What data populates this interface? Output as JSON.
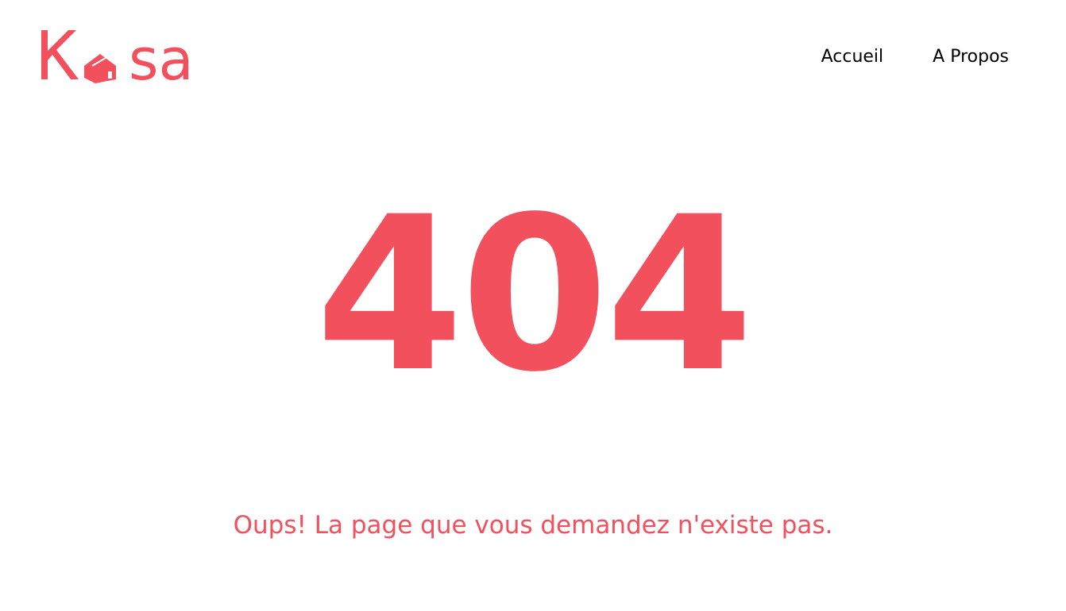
{
  "brand": {
    "logo_text": "Kasa",
    "accent_color": "#F2505D"
  },
  "nav": {
    "items": [
      {
        "label": "Accueil"
      },
      {
        "label": "A Propos"
      }
    ]
  },
  "error": {
    "code": "404",
    "message": "Oups! La page que vous demandez n'existe pas."
  },
  "icons": {
    "logo_house": "house-icon"
  }
}
